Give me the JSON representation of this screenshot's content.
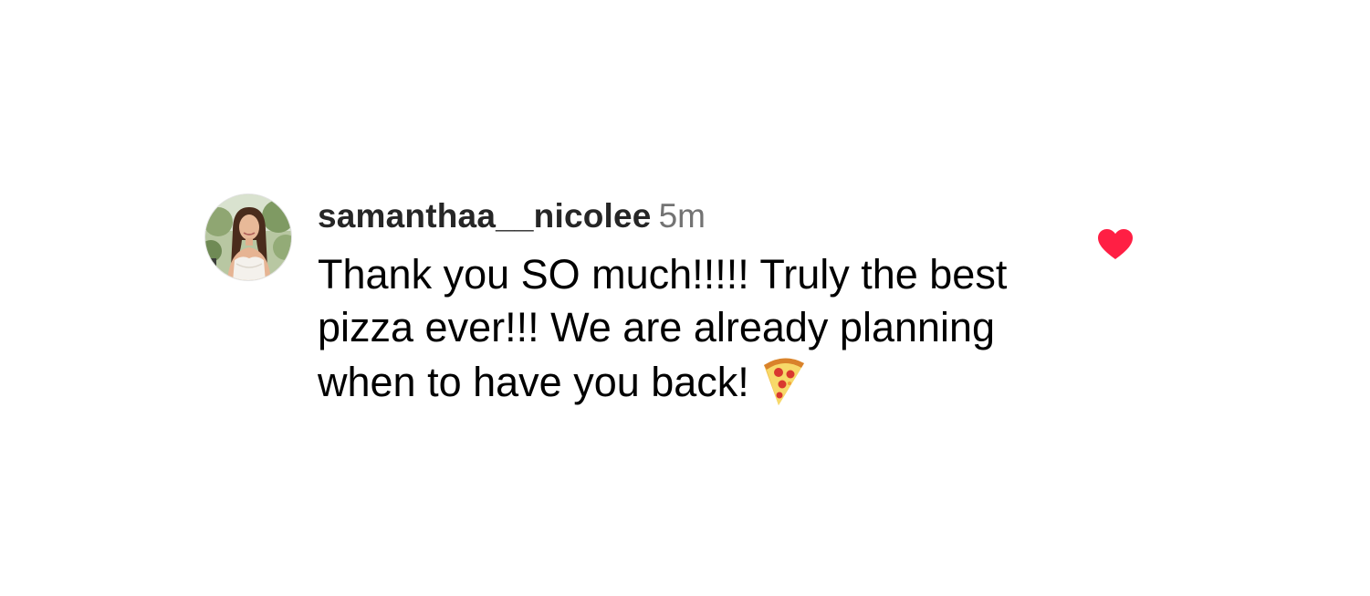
{
  "comment": {
    "username": "samanthaa__nicolee",
    "timestamp": "5m",
    "text": "Thank you SO much!!!!! Truly the best pizza ever!!! We are already planning when to have you back!",
    "emoji": "pizza-icon",
    "liked": true
  },
  "colors": {
    "like_heart": "#ff1f44",
    "username": "#262626",
    "timestamp": "#737373"
  }
}
